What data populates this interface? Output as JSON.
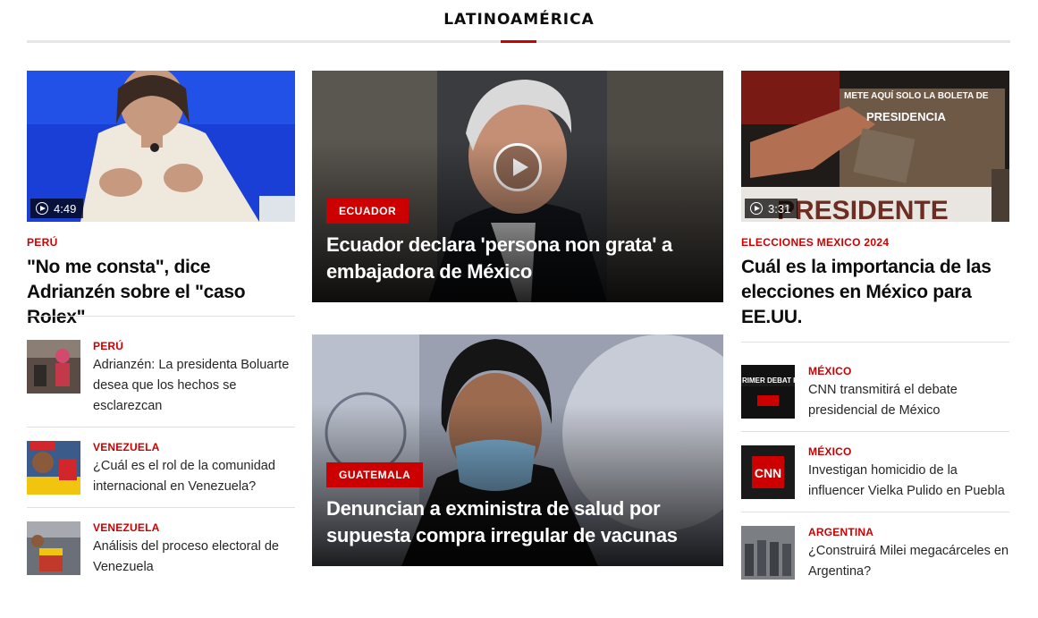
{
  "section": {
    "title": "LATINOAMÉRICA"
  },
  "left": {
    "lead": {
      "duration": "4:49",
      "kicker": "PERÚ",
      "headline": "\"No me consta\", dice Adrianzén sobre el \"caso Rolex\""
    },
    "items": [
      {
        "kicker": "PERÚ",
        "text": "Adrianzén: La presidenta Boluarte desea que los hechos se esclarezcan"
      },
      {
        "kicker": "VENEZUELA",
        "text": "¿Cuál es el rol de la comunidad internacional en Venezuela?"
      },
      {
        "kicker": "VENEZUELA",
        "text": "Análisis del proceso electoral de Venezuela"
      }
    ]
  },
  "center": {
    "feature1": {
      "tag": "ECUADOR",
      "headline": "Ecuador declara 'persona non grata' a embajadora de México"
    },
    "feature2": {
      "tag": "GUATEMALA",
      "headline": "Denuncian a exministra de salud por supuesta compra irregular de vacunas"
    }
  },
  "right": {
    "lead": {
      "duration": "3:31",
      "kicker": "ELECCIONES MEXICO 2024",
      "headline": "Cuál es la importancia de las elecciones en México para EE.UU.",
      "image_text": {
        "sign": "METE AQUÍ SOLO LA BOLETA DE",
        "sign2": "PRESIDENCIA",
        "box": "PRESIDENTE"
      }
    },
    "items": [
      {
        "kicker": "MÉXICO",
        "text": "CNN transmitirá el debate presidencial de México",
        "thumb_text": "RIMER DEBAT PRESIDENCIAL"
      },
      {
        "kicker": "MÉXICO",
        "text": "Investigan homicidio de la influencer Vielka Pulido en Puebla",
        "thumb_text": "CNN"
      },
      {
        "kicker": "ARGENTINA",
        "text": "¿Construirá Milei megacárceles en Argentina?"
      }
    ]
  },
  "colors": {
    "accent": "#cc0000",
    "text": "#0c0c0c",
    "divider": "#e0e0e0"
  }
}
